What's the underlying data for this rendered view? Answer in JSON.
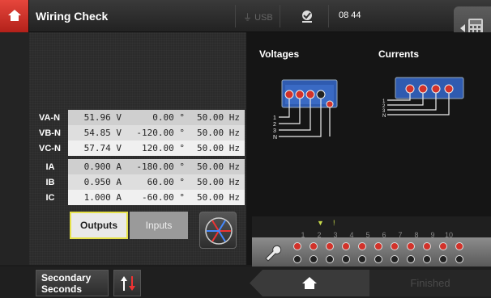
{
  "header": {
    "title": "Wiring Check",
    "usb": "USB",
    "time": "08 44"
  },
  "measurements": {
    "voltages": [
      {
        "label": "VA-N",
        "magnitude": "51.96 V",
        "angle": "0.00 °",
        "frequency": "50.00 Hz"
      },
      {
        "label": "VB-N",
        "magnitude": "54.85 V",
        "angle": "-120.00 °",
        "frequency": "50.00 Hz"
      },
      {
        "label": "VC-N",
        "magnitude": "57.74 V",
        "angle": "120.00 °",
        "frequency": "50.00 Hz"
      }
    ],
    "currents": [
      {
        "label": "IA",
        "magnitude": "0.900 A",
        "angle": "-180.00 °",
        "frequency": "50.00 Hz"
      },
      {
        "label": "IB",
        "magnitude": "0.950 A",
        "angle": "60.00 °",
        "frequency": "50.00 Hz"
      },
      {
        "label": "IC",
        "magnitude": "1.000 A",
        "angle": "-60.00 °",
        "frequency": "50.00 Hz"
      }
    ]
  },
  "tabs": {
    "outputs": "Outputs",
    "inputs": "Inputs"
  },
  "diagrams": {
    "voltages_title": "Voltages",
    "currents_title": "Currents",
    "wire_labels": [
      "1",
      "2",
      "3",
      "N"
    ]
  },
  "channels": {
    "numbers": [
      "1",
      "2",
      "3",
      "4",
      "5",
      "6",
      "7",
      "8",
      "9",
      "10"
    ],
    "active_markers": [
      "▼",
      "!"
    ]
  },
  "footer": {
    "mode_line1": "Secondary",
    "mode_line2": "Seconds",
    "finished": "Finished"
  },
  "colors": {
    "accent_red": "#d2322a",
    "highlight_yellow": "#e6e24a",
    "device_blue": "#2f5bb0"
  }
}
